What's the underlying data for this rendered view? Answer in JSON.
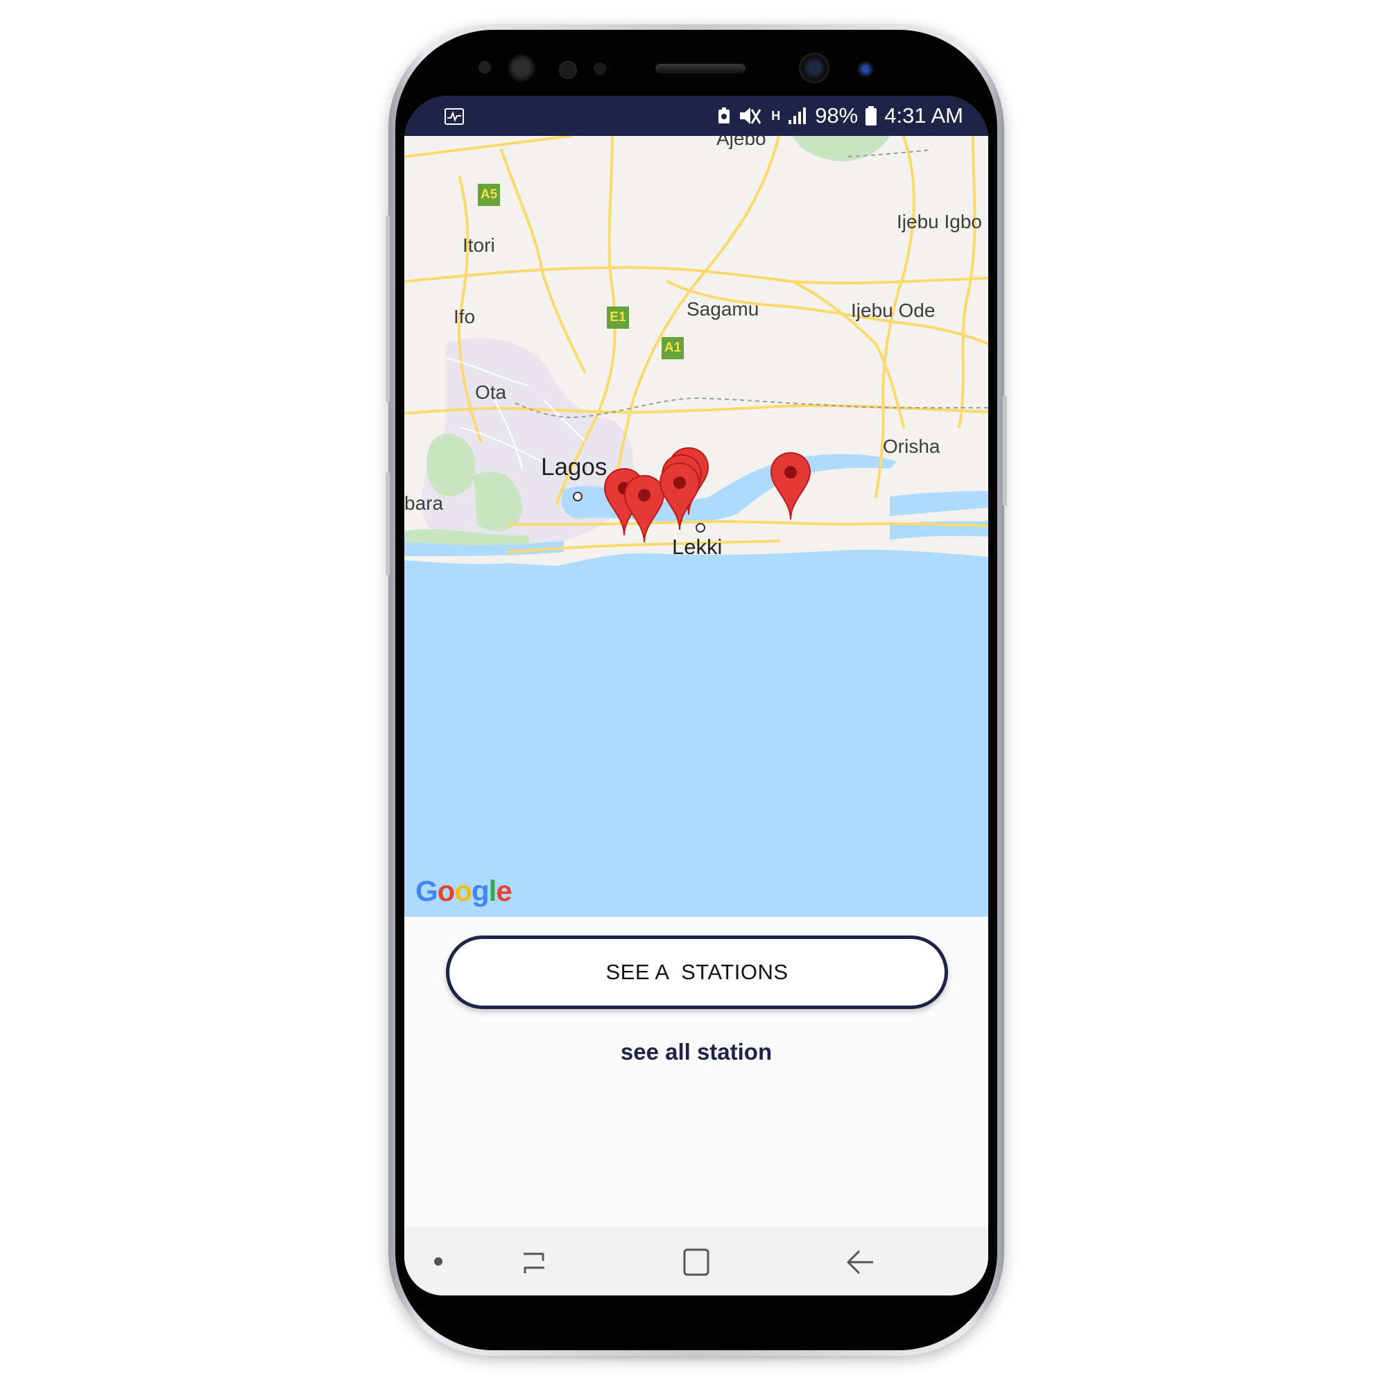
{
  "statusbar": {
    "battery_percent": "98%",
    "time": "4:31 AM",
    "network_type": "H",
    "icons": [
      "activity-icon",
      "battery-saver-icon",
      "mute-icon",
      "data-transfer-icon",
      "signal-icon",
      "battery-icon"
    ]
  },
  "map": {
    "labels": {
      "ajebo": "Ajebo",
      "itori": "Itori",
      "ijebu_igbo": "Ijebu Igbo",
      "ifo": "Ifo",
      "sagamu": "Sagamu",
      "ijebu_ode": "Ijebu Ode",
      "ota": "Ota",
      "orisha": "Orisha",
      "lagos": "Lagos",
      "badagry_partial": "bara",
      "lekki": "Lekki"
    },
    "road_badges": {
      "a5": "A5",
      "e1": "E1",
      "a1": "A1"
    },
    "attribution": "Google",
    "marker_count": 6,
    "colors": {
      "water": "#aedbfd",
      "land": "#f5f3f0",
      "road": "#fbd96a",
      "marker": "#e53935"
    }
  },
  "actions": {
    "primary_button": "SEE A  STATIONS",
    "secondary_link": "see all station"
  },
  "navbar": {
    "icons": [
      "home-dot-icon",
      "recent-apps-icon",
      "home-icon",
      "back-icon"
    ]
  },
  "theme": {
    "accent": "#1e2348"
  }
}
